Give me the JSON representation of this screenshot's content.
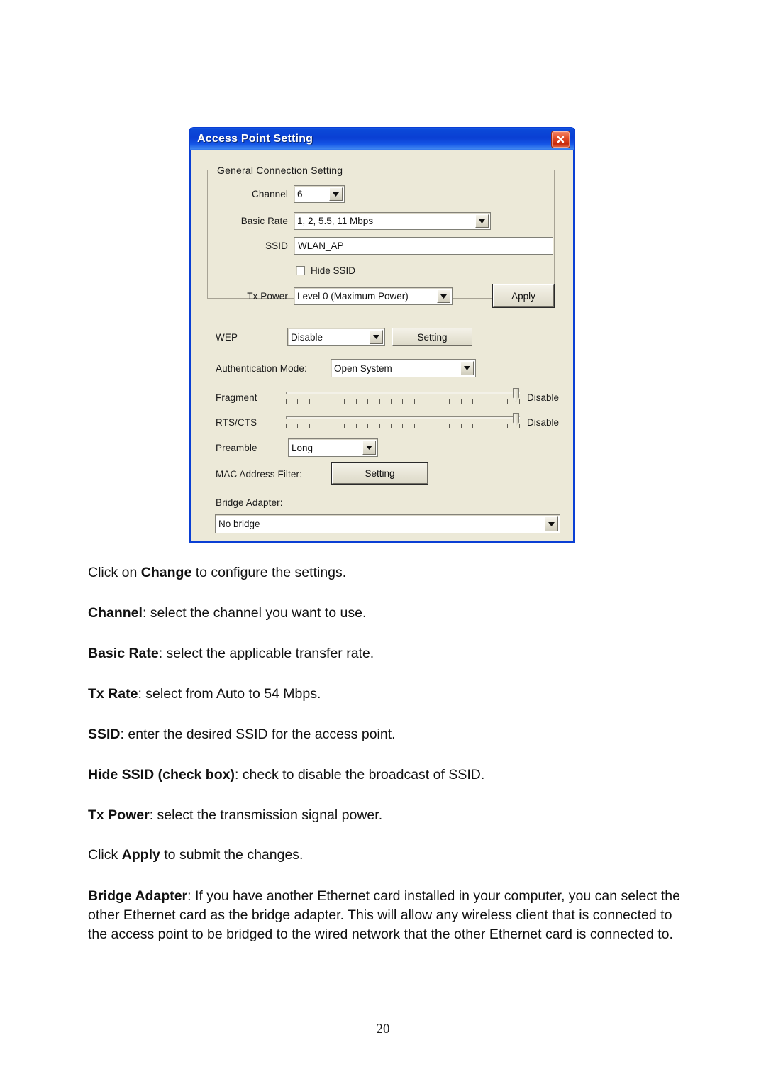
{
  "dialog": {
    "title": "Access Point Setting",
    "close_icon": "close-icon",
    "groupbox": {
      "legend": "General Connection Setting"
    },
    "fields": {
      "channel": {
        "label": "Channel",
        "value": "6"
      },
      "basic_rate": {
        "label": "Basic Rate",
        "value": "1, 2, 5.5, 11 Mbps"
      },
      "ssid": {
        "label": "SSID",
        "value": "WLAN_AP"
      },
      "hide_ssid": {
        "label": "Hide SSID",
        "checked": false
      },
      "tx_power": {
        "label": "Tx Power",
        "value": "Level 0 (Maximum Power)"
      },
      "apply": {
        "label": "Apply"
      },
      "wep": {
        "label": "WEP",
        "value": "Disable",
        "button": "Setting"
      },
      "auth_mode": {
        "label": "Authentication Mode:",
        "value": "Open System"
      },
      "fragment": {
        "label": "Fragment",
        "state": "Disable"
      },
      "rts_cts": {
        "label": "RTS/CTS",
        "state": "Disable"
      },
      "preamble": {
        "label": "Preamble",
        "value": "Long"
      },
      "mac_filter": {
        "label": "MAC Address Filter:",
        "button": "Setting"
      },
      "bridge_adapter": {
        "label": "Bridge Adapter:",
        "value": "No bridge"
      }
    },
    "colors": {
      "titlebar": "#0A3FD4",
      "dialog_face": "#ECE9D8",
      "close_button": "#C8290B"
    }
  },
  "prose": {
    "p1_pre": "Click on ",
    "p1_bold": "Change",
    "p1_post": " to configure the settings.",
    "p2_bold": "Channel",
    "p2_post": ": select the channel you want to use.",
    "p3_bold": "Basic Rate",
    "p3_post": ": select the applicable transfer rate.",
    "p4_bold": "Tx Rate",
    "p4_post": ": select from Auto to 54 Mbps.",
    "p5_bold": "SSID",
    "p5_post": ": enter the desired SSID for the access point.",
    "p6_bold": "Hide SSID (check box)",
    "p6_post": ": check to disable the broadcast of SSID.",
    "p7_bold": "Tx Power",
    "p7_post": ": select the transmission signal power.",
    "p8_pre": "Click ",
    "p8_bold": "Apply",
    "p8_post": " to submit the changes.",
    "p9_bold": "Bridge Adapter",
    "p9_post": ": If you have another Ethernet card installed in your computer, you can select the other Ethernet card as the bridge adapter. This will allow any wireless client that is connected to the access point to be bridged to the wired network that the other Ethernet card is connected to."
  },
  "page_number": "20"
}
